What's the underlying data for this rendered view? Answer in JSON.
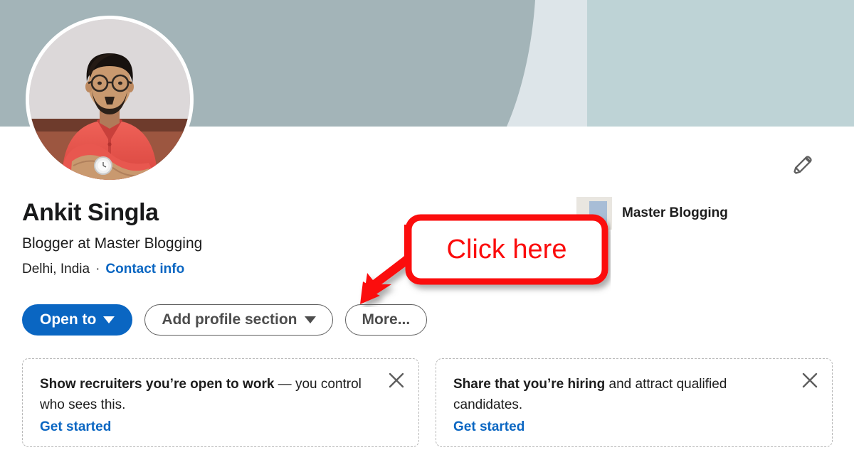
{
  "banner": {
    "region_left_color": "#a3b4b8",
    "region_mid_color": "#dde5e9",
    "region_right_color": "#bed3d6"
  },
  "avatar": {
    "alt": "Ankit Singla profile photo",
    "shirt_color": "#e8574f",
    "wall_color": "#d9d5d6",
    "skin_color": "#c99572",
    "hair_color": "#1b1410"
  },
  "edit": {
    "icon": "pencil-icon",
    "color": "#5f5f5f"
  },
  "profile": {
    "name": "Ankit Singla",
    "headline": "Blogger at Master Blogging",
    "location": "Delhi, India",
    "separator": "·",
    "contact_info": "Contact info",
    "contact_info_color": "#0a66c2"
  },
  "actions": {
    "open_to": "Open to",
    "add_profile_section": "Add profile section",
    "more": "More...",
    "primary_color": "#0a66c2"
  },
  "company": {
    "name": "Master Blogging",
    "logo_bg": "#e9e6e0",
    "logo_shape": "#a8bdd6"
  },
  "annotation": {
    "text": "Click here",
    "border_color": "#fb0b0b",
    "text_color": "#fb0b0b",
    "fill_color": "#ffffff",
    "points_to": "Add profile section"
  },
  "cards": [
    {
      "bold_text": "Show recruiters you’re open to work",
      "rest_text": " — you control who sees this.",
      "link": "Get started",
      "close_icon": "close-icon"
    },
    {
      "bold_text": "Share that you’re hiring",
      "rest_text": " and attract qualified candidates.",
      "link": "Get started",
      "close_icon": "close-icon"
    }
  ]
}
